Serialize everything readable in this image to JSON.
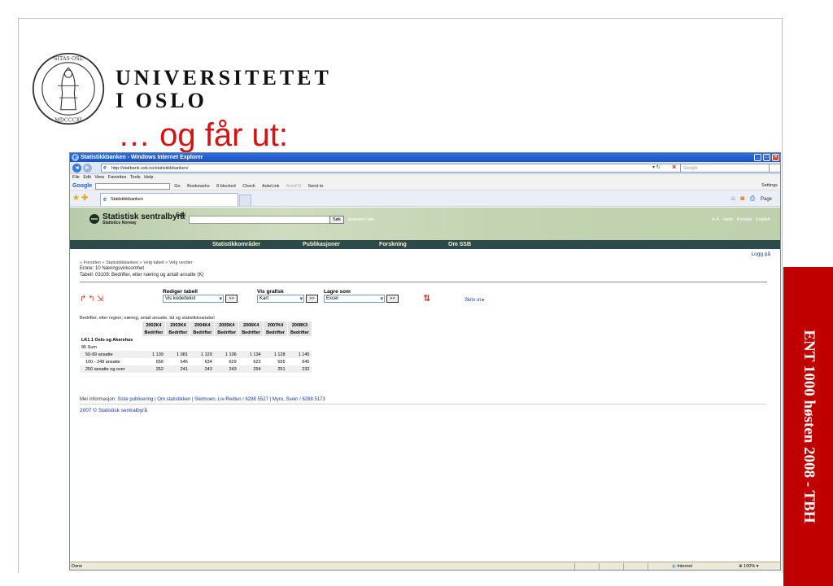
{
  "slide": {
    "university_line1": "UNIVERSITETET",
    "university_line2": "I OSLO",
    "heading": "… og får ut:",
    "side_banner": "ENT 1000 høsten 2008 - TBH",
    "colors": {
      "heading": "#d41313",
      "banner": "#c00000"
    }
  },
  "browser": {
    "window_title": "Statistikkbanken - Windows Internet Explorer",
    "url": "http://statbank.ssb.no/statistikkbanken/",
    "search_placeholder": "Google",
    "menu": "File  Edit  View  Favorites  Tools  Help",
    "googlebar": {
      "logo": "Google",
      "go": "Go",
      "items": [
        "Bookmarks",
        "8 blocked",
        "Check",
        "AutoLink",
        "AutoFill",
        "Send to"
      ],
      "settings": "Settings"
    },
    "tab_title": "Statistikkbanken",
    "tab_tools": [
      "Page"
    ],
    "status_left": "Done",
    "status_zone": "Internet",
    "status_zoom": "100%"
  },
  "ssb": {
    "name": "Statistisk sentralbyrå",
    "sub": "Statistics Norway",
    "search_label": "Søk",
    "search_button": "Søk",
    "advanced_search": "Avansert søk",
    "top_links": "A-Å  Hjelp  Kontakt  English",
    "nav": [
      "Statistikkområder",
      "Publikasjoner",
      "Forskning",
      "Om SSB"
    ],
    "accent": "#2d4a4a"
  },
  "page": {
    "login": "Logg på",
    "breadcrumb": "» Forsiden » Statistikkbanken » Velg tabell » Velg verdier",
    "emne": "Emne: 10 Næringsvirksomhet",
    "tabell": "Tabell: 03109: Bedrifter, etter næring og antall ansatte (K)",
    "tools": {
      "edit_label": "Rediger tabell",
      "edit_value": "Vis kode/tekst",
      "graph_label": "Vis grafisk",
      "graph_value": "Kart",
      "save_label": "Lagre som",
      "save_value": "Excel",
      "go": ">>",
      "print": "Skriv ut"
    },
    "table_caption": "Bedrifter, etter region, næring, antall ansatte, tid og statistikkvariabel",
    "table": {
      "periods": [
        "2002K4",
        "2003K4",
        "2004K4",
        "2005K4",
        "2006K4",
        "2007K4",
        "2008K3"
      ],
      "measure": "Bedrifter",
      "region": "LK1 1 Oslo og Akershus",
      "group": "95 Sum",
      "rows": [
        {
          "label": "50-99 ansatte",
          "values": [
            "1 139",
            "1 081",
            "1 120",
            "1 106",
            "1 134",
            "1 128",
            "1 145"
          ]
        },
        {
          "label": "100 - 249 ansatte",
          "values": [
            "656",
            "645",
            "634",
            "629",
            "623",
            "655",
            "645"
          ]
        },
        {
          "label": "250 ansatte og over",
          "values": [
            "252",
            "241",
            "243",
            "243",
            "254",
            "251",
            "232"
          ]
        }
      ]
    },
    "more_info_prefix": "Mer informasjon:",
    "more_info_links": "Siste publisering | Om statistikken |  Sletmoen, Liv-Reidun / 6288 5527 | Myro, Svein / 6288 5173",
    "copyright": "2007 © Statistisk sentralbyrå"
  }
}
